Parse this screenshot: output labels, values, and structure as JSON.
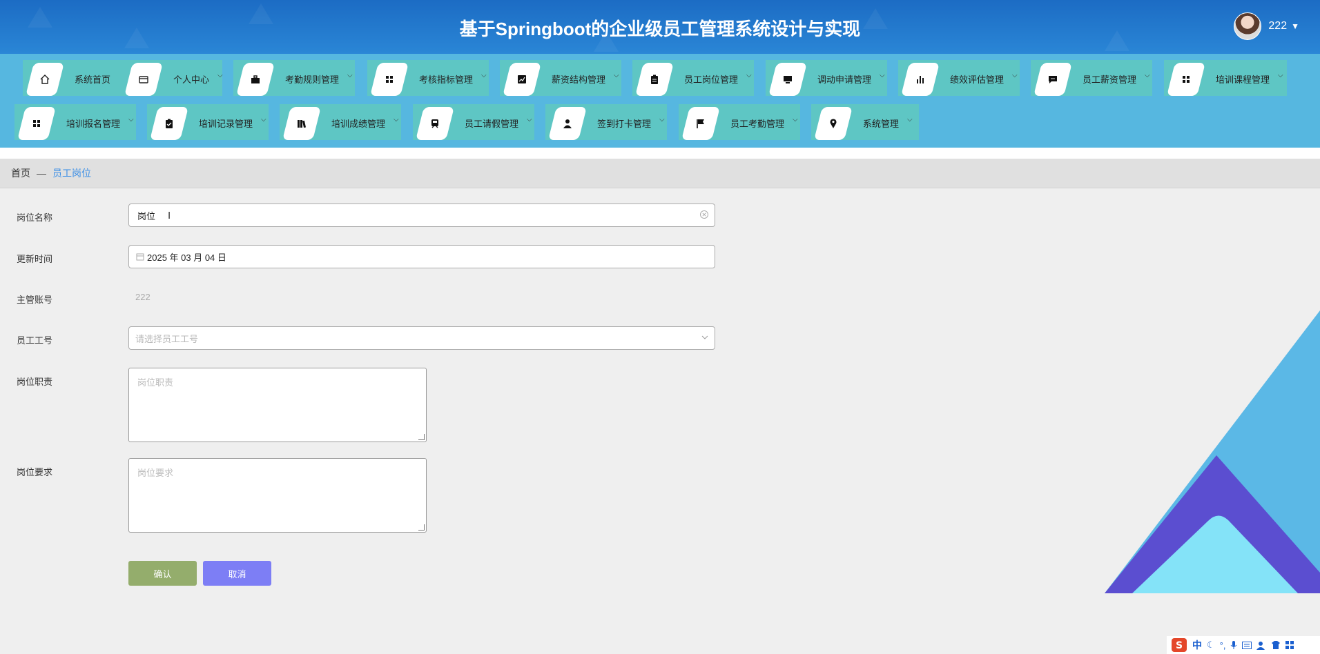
{
  "header": {
    "title": "基于Springboot的企业级员工管理系统设计与实现",
    "username": "222"
  },
  "nav": {
    "items": [
      {
        "label": "系统首页",
        "icon": "home-icon",
        "has_dropdown": false
      },
      {
        "label": "个人中心",
        "icon": "wallet-icon",
        "has_dropdown": true
      },
      {
        "label": "考勤规则管理",
        "icon": "briefcase-icon",
        "has_dropdown": true
      },
      {
        "label": "考核指标管理",
        "icon": "grid-icon",
        "has_dropdown": true
      },
      {
        "label": "薪资结构管理",
        "icon": "chart-icon",
        "has_dropdown": true
      },
      {
        "label": "员工岗位管理",
        "icon": "clipboard-icon",
        "has_dropdown": true
      },
      {
        "label": "调动申请管理",
        "icon": "monitor-icon",
        "has_dropdown": true
      },
      {
        "label": "绩效评估管理",
        "icon": "bar-chart-icon",
        "has_dropdown": true
      },
      {
        "label": "员工薪资管理",
        "icon": "message-icon",
        "has_dropdown": true
      },
      {
        "label": "培训课程管理",
        "icon": "grid-icon",
        "has_dropdown": true
      },
      {
        "label": "培训报名管理",
        "icon": "grid-icon",
        "has_dropdown": true
      },
      {
        "label": "培训记录管理",
        "icon": "clipboard-check-icon",
        "has_dropdown": true
      },
      {
        "label": "培训成绩管理",
        "icon": "books-icon",
        "has_dropdown": true
      },
      {
        "label": "员工请假管理",
        "icon": "train-icon",
        "has_dropdown": true
      },
      {
        "label": "签到打卡管理",
        "icon": "user-icon",
        "has_dropdown": true
      },
      {
        "label": "员工考勤管理",
        "icon": "flag-icon",
        "has_dropdown": true
      },
      {
        "label": "系统管理",
        "icon": "pin-icon",
        "has_dropdown": true
      }
    ]
  },
  "breadcrumb": {
    "home": "首页",
    "separator": "—",
    "current": "员工岗位"
  },
  "form": {
    "position_name": {
      "label": "岗位名称",
      "value": "岗位"
    },
    "update_time": {
      "label": "更新时间",
      "value": "2025 年 03 月 04 日"
    },
    "manager_account": {
      "label": "主管账号",
      "value": "222"
    },
    "employee_id": {
      "label": "员工工号",
      "placeholder": "请选择员工工号"
    },
    "duties": {
      "label": "岗位职责",
      "placeholder": "岗位职责"
    },
    "requirements": {
      "label": "岗位要求",
      "placeholder": "岗位要求"
    },
    "confirm": "确认",
    "cancel": "取消"
  },
  "ime": {
    "lang": "中"
  },
  "colors": {
    "header": "#1c6cc4",
    "nav_bg": "#56b7e0",
    "nav_item": "#5ec6c4",
    "breadcrumb_current": "#3a8ee6",
    "confirm_button": "#94ad6c",
    "cancel_button": "#7d7ef5",
    "deco_light": "#5bb8e6",
    "deco_purple": "#5b4ed0",
    "deco_cyan": "#84e3f8"
  }
}
